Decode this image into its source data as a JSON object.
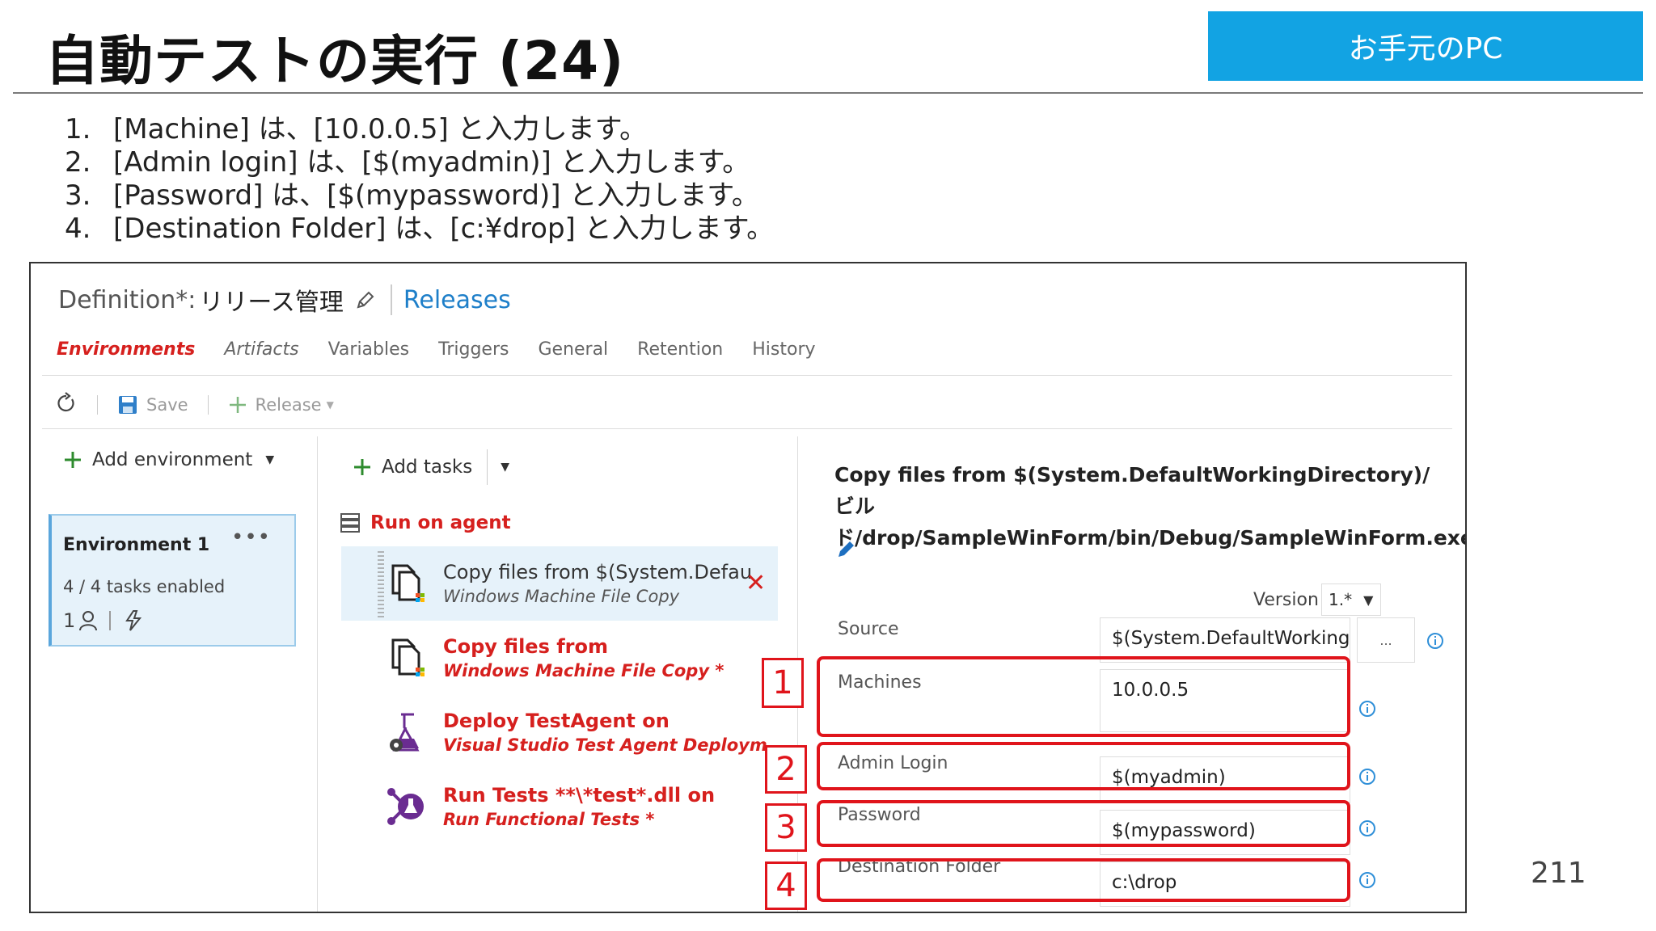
{
  "slide": {
    "title": "自動テストの実行 (24)",
    "badge": "お手元のPC",
    "page_number": "211",
    "steps": [
      {
        "num": "1.",
        "text": "[Machine] は、[10.0.0.5] と入力します。"
      },
      {
        "num": "2.",
        "text": "[Admin login] は、[$(myadmin)] と入力します。"
      },
      {
        "num": "3.",
        "text": "[Password] は、[$(mypassword)] と入力します。"
      },
      {
        "num": "4.",
        "text": "[Destination Folder] は、[c:¥drop] と入力します。"
      }
    ]
  },
  "app": {
    "definition_label": "Definition*:",
    "definition_name": "リリース管理",
    "releases_link": "Releases",
    "tabs": [
      "Environments",
      "Artifacts",
      "Variables",
      "Triggers",
      "General",
      "Retention",
      "History"
    ],
    "toolbar": {
      "save_label": "Save",
      "release_label": "Release"
    },
    "environments": {
      "add_label": "Add environment",
      "card": {
        "title": "Environment 1",
        "more": "•••",
        "tasks": "4 / 4 tasks enabled",
        "approvers": "1"
      }
    },
    "tasks": {
      "add_label": "Add tasks",
      "phase_label": "Run on agent",
      "items": [
        {
          "name": "Copy files from $(System.Defau",
          "sub": "Windows Machine File Copy",
          "icon": "file-copy-icon"
        },
        {
          "name": "Copy files from",
          "sub": "Windows Machine File Copy *",
          "icon": "file-copy-icon"
        },
        {
          "name": "Deploy TestAgent on",
          "sub": "Visual Studio Test Agent Deploym",
          "icon": "test-agent-icon"
        },
        {
          "name": "Run Tests **\\*test*.dll on",
          "sub": "Run Functional Tests *",
          "icon": "functional-test-icon"
        }
      ]
    },
    "details": {
      "title": "Copy files from $(System.DefaultWorkingDirectory)/ビルド/drop/SampleWinForm/bin/Debug/SampleWinForm.exe",
      "version_label": "Version",
      "version_value": "1.*",
      "browse_label": "...",
      "fields": [
        {
          "label": "Source",
          "value": "$(System.DefaultWorking"
        },
        {
          "label": "Machines",
          "value": "10.0.0.5"
        },
        {
          "label": "Admin Login",
          "value": "$(myadmin)"
        },
        {
          "label": "Password",
          "value": "$(mypassword)"
        },
        {
          "label": "Destination Folder",
          "value": "c:\\drop"
        }
      ]
    }
  },
  "callouts": [
    "1",
    "2",
    "3",
    "4"
  ],
  "colors": {
    "accent_red": "#d6201e",
    "callout_red": "#e0141b",
    "badge_blue": "#12a3e3",
    "link_blue": "#1e7fc9",
    "selection": "#e6f2fa"
  }
}
